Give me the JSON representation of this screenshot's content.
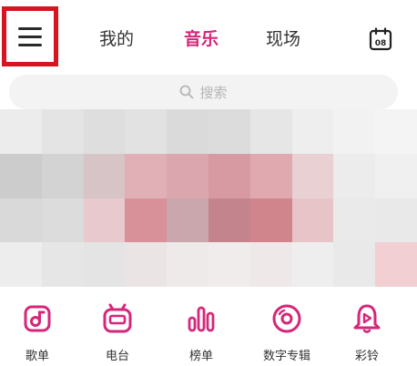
{
  "header": {
    "tabs": [
      {
        "label": "我的",
        "active": false
      },
      {
        "label": "音乐",
        "active": true
      },
      {
        "label": "现场",
        "active": false
      }
    ],
    "calendar_day": "08"
  },
  "search": {
    "placeholder": "搜索"
  },
  "quick_access": [
    {
      "label": "歌单",
      "icon": "playlist-icon"
    },
    {
      "label": "电台",
      "icon": "radio-icon"
    },
    {
      "label": "榜单",
      "icon": "chart-icon"
    },
    {
      "label": "数字专辑",
      "icon": "album-icon"
    },
    {
      "label": "彩铃",
      "icon": "ringtone-bell-icon"
    }
  ],
  "colors": {
    "accent": "#d6267a",
    "highlight_border": "#d7141f",
    "text": "#333333",
    "search_bg": "#f3f3f3"
  }
}
